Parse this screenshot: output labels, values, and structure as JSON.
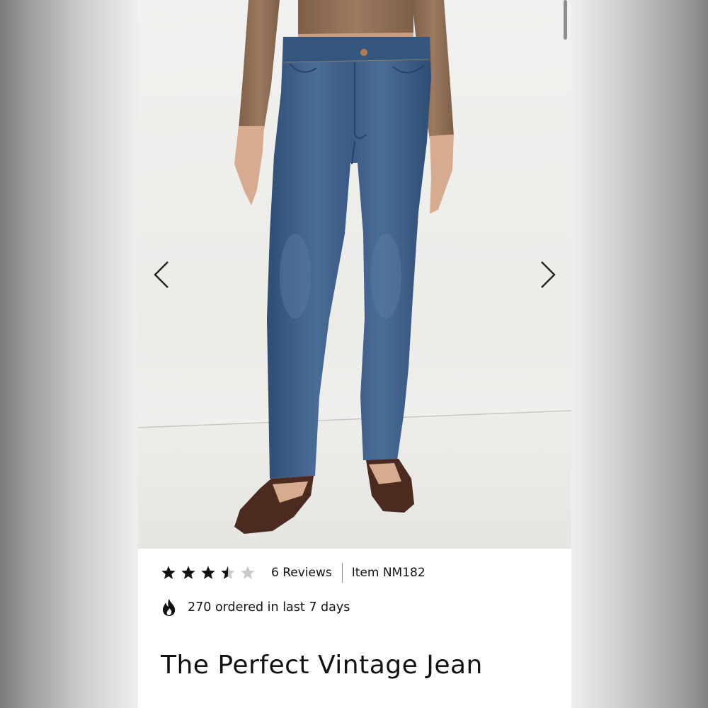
{
  "product": {
    "title": "The Perfect Vintage Jean",
    "rating": 3.5,
    "rating_max": 5,
    "reviews_label": "6 Reviews",
    "item_label": "Item NM182",
    "popularity_text": "270 ordered in last 7 days"
  },
  "gallery": {
    "prev_icon": "chevron-left-icon",
    "next_icon": "chevron-right-icon",
    "image_subject": "model wearing blue straight-leg jeans, brown ribbed top, brown flats"
  },
  "colors": {
    "text": "#111111",
    "star_filled": "#111111",
    "star_empty": "#c9c9c9",
    "denim": "#3e5f89"
  }
}
